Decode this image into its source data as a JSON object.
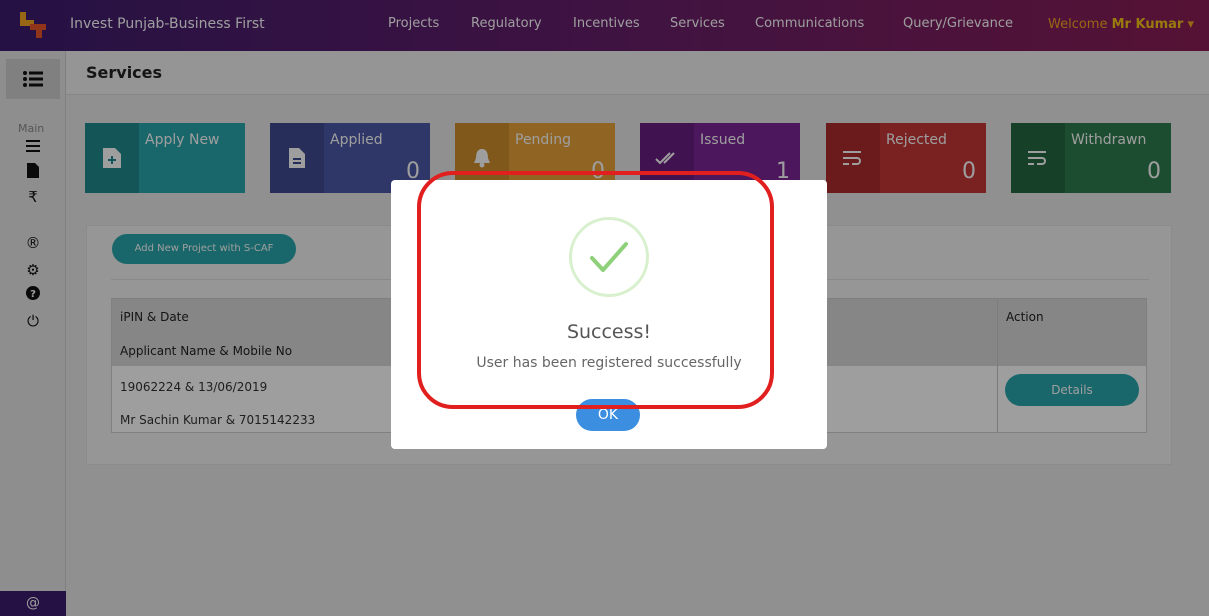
{
  "app": {
    "brand": "Invest Punjab-Business First",
    "nav": [
      "Projects",
      "Regulatory",
      "Incentives",
      "Services",
      "Communications",
      "Query/Grievance"
    ],
    "welcome_prefix": "Welcome",
    "user_name": "Mr Kumar",
    "welcome_caret": "▾"
  },
  "sidebar": {
    "section_label": "Main",
    "icons": [
      "list-icon",
      "file-icon",
      "rupee-icon",
      "registered-icon",
      "gears-icon",
      "help-icon",
      "power-icon"
    ],
    "bottom_icon_glyph": "@"
  },
  "page": {
    "title": "Services"
  },
  "tiles": [
    {
      "label": "Apply New",
      "count": "",
      "color": "#2aa7ad",
      "icon": "plus-file-icon"
    },
    {
      "label": "Applied",
      "count": "0",
      "color": "#4c59a8",
      "icon": "document-icon"
    },
    {
      "label": "Pending",
      "count": "0",
      "color": "#e8a33b",
      "icon": "bell-icon"
    },
    {
      "label": "Issued",
      "count": "1",
      "color": "#7b2696",
      "icon": "double-check-icon"
    },
    {
      "label": "Rejected",
      "count": "0",
      "color": "#c63737",
      "icon": "wrap-icon"
    },
    {
      "label": "Withdrawn",
      "count": "0",
      "color": "#2e7d4f",
      "icon": "wrap-icon"
    }
  ],
  "card": {
    "add_button": "Add New Project with S-CAF",
    "table": {
      "headers": {
        "ipin_date": "iPIN & Date",
        "applicant": "Applicant Name & Mobile No",
        "action": "Action"
      },
      "rows": [
        {
          "ipin_date": "19062224 & 13/06/2019",
          "applicant": "Mr Sachin Kumar & 7015142233",
          "action": "Details"
        }
      ]
    }
  },
  "modal": {
    "title": "Success!",
    "message": "User has been registered successfully",
    "ok": "OK"
  },
  "colors": {
    "accent": "#2aa7ad",
    "highlight": "#e21f1f",
    "success": "#8fd17a",
    "ok_button": "#3b8ee0"
  }
}
